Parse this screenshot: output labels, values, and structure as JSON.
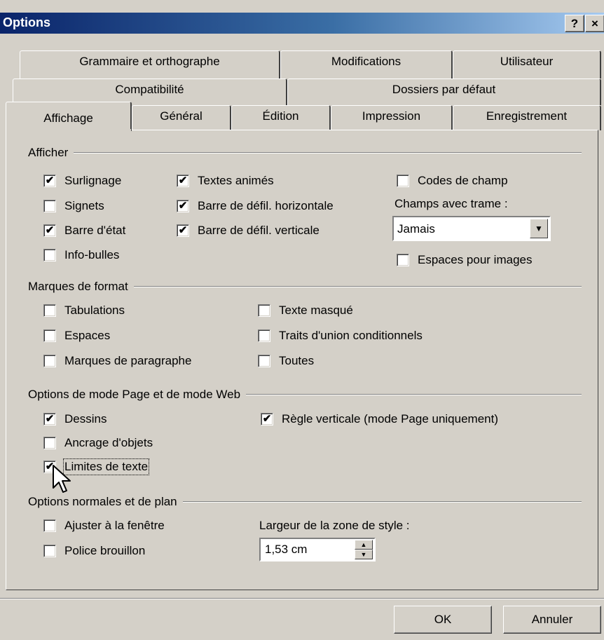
{
  "window": {
    "title": "Options",
    "help_label": "?",
    "close_label": "×"
  },
  "tabs": {
    "row1": [
      "Grammaire et orthographe",
      "Modifications",
      "Utilisateur"
    ],
    "row2": [
      "Compatibilité",
      "Dossiers par défaut"
    ],
    "row3": [
      "Affichage",
      "Général",
      "Édition",
      "Impression",
      "Enregistrement"
    ],
    "active": "Affichage"
  },
  "afficher": {
    "title": "Afficher",
    "items": [
      {
        "label": "Surlignage",
        "checked": true
      },
      {
        "label": "Signets",
        "checked": false
      },
      {
        "label": "Barre d'état",
        "checked": true
      },
      {
        "label": "Info-bulles",
        "checked": false
      },
      {
        "label": "Textes animés",
        "checked": true
      },
      {
        "label": "Barre de défil. horizontale",
        "checked": true
      },
      {
        "label": "Barre de défil. verticale",
        "checked": true
      },
      {
        "label": "Codes de champ",
        "checked": false
      },
      {
        "label": "Espaces pour images",
        "checked": false
      }
    ],
    "champs_label": "Champs avec trame :",
    "champs_value": "Jamais"
  },
  "marques": {
    "title": "Marques de format",
    "items": [
      {
        "label": "Tabulations",
        "checked": false
      },
      {
        "label": "Espaces",
        "checked": false
      },
      {
        "label": "Marques de paragraphe",
        "checked": false
      },
      {
        "label": "Texte masqué",
        "checked": false
      },
      {
        "label": "Traits d'union conditionnels",
        "checked": false
      },
      {
        "label": "Toutes",
        "checked": false
      }
    ]
  },
  "page_web": {
    "title": "Options de mode Page et de mode Web",
    "items": [
      {
        "label": "Dessins",
        "checked": true
      },
      {
        "label": "Ancrage d'objets",
        "checked": false
      },
      {
        "label": "Limites de texte",
        "checked": true
      },
      {
        "label": "Règle verticale (mode Page uniquement)",
        "checked": true
      }
    ]
  },
  "normales": {
    "title": "Options normales et de plan",
    "items": [
      {
        "label": "Ajuster à la fenêtre",
        "checked": false
      },
      {
        "label": "Police brouillon",
        "checked": false
      }
    ],
    "largeur_label": "Largeur de la zone de style :",
    "largeur_value": "1,53 cm"
  },
  "buttons": {
    "ok": "OK",
    "cancel": "Annuler"
  }
}
